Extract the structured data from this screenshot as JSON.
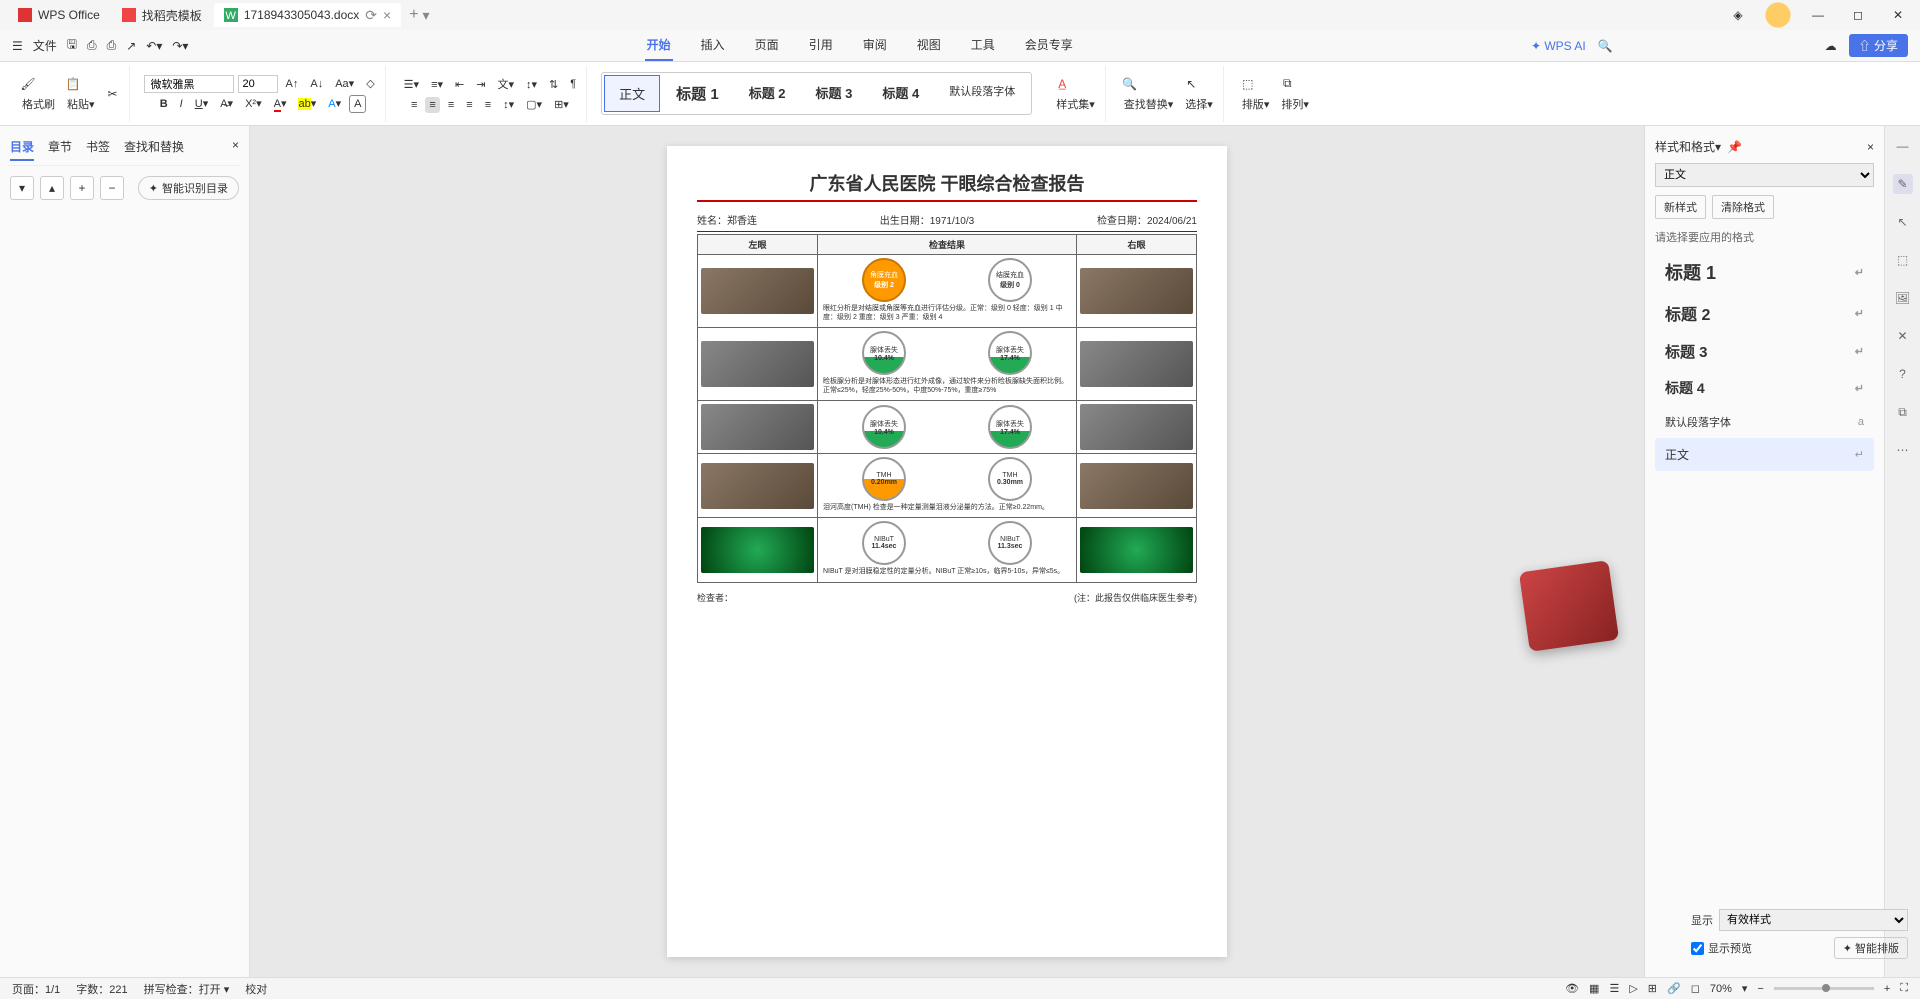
{
  "titlebar": {
    "app": "WPS Office",
    "tab_template": "找稻壳模板",
    "tab_doc": "1718943305043.docx"
  },
  "menubar": {
    "file": "文件",
    "tabs": {
      "start": "开始",
      "insert": "插入",
      "page": "页面",
      "ref": "引用",
      "review": "审阅",
      "view": "视图",
      "tools": "工具",
      "member": "会员专享"
    },
    "ai": "WPS AI",
    "share": "分享"
  },
  "ribbon": {
    "format_painter": "格式刷",
    "paste": "粘贴",
    "font": "微软雅黑",
    "size": "20",
    "styles": {
      "body": "正文",
      "h1": "标题 1",
      "h2": "标题 2",
      "h3": "标题 3",
      "h4": "标题 4",
      "default_para": "默认段落字体"
    },
    "style_set": "样式集",
    "find_replace": "查找替换",
    "select": "选择",
    "arrange1": "排版",
    "arrange2": "排列"
  },
  "left_panel": {
    "tabs": {
      "outline": "目录",
      "chapter": "章节",
      "bookmark": "书签",
      "find": "查找和替换"
    },
    "smart": "智能识别目录"
  },
  "right_panel": {
    "title": "样式和格式",
    "current": "正文",
    "new_style": "新样式",
    "clear": "清除格式",
    "apply_label": "请选择要应用的格式",
    "h1": "标题 1",
    "h2": "标题 2",
    "h3": "标题 3",
    "h4": "标题 4",
    "default_para": "默认段落字体",
    "body": "正文",
    "show": "显示",
    "show_val": "有效样式",
    "preview": "显示预览",
    "smart_layout": "智能排版"
  },
  "doc": {
    "title": "广东省人民医院 干眼综合检查报告",
    "name_lbl": "姓名：",
    "name": "郑香连",
    "dob_lbl": "出生日期：",
    "dob": "1971/10/3",
    "exam_lbl": "检查日期：",
    "exam": "2024/06/21",
    "col_left": "左眼",
    "col_mid": "检查结果",
    "col_right": "右眼",
    "r1": {
      "c1_t": "角膜充血",
      "c1_v": "级别 2",
      "c2_t": "结膜充血",
      "c2_v": "级别 0",
      "desc": "眼红分析是对结膜或角膜等充血进行评估分级。正常：级别 0  轻度：级别 1  中度：级别 2  重度：级别 3  严重：级别 4"
    },
    "r2": {
      "c1_t": "腺体丢失",
      "c1_v": "10.4%",
      "c2_t": "腺体丢失",
      "c2_v": "17.4%",
      "desc": "睑板腺分析是对腺体形态进行红外成像，通过软件来分析睑板腺缺失面积比例。正常≤25%，轻度25%-50%，中度50%-75%，重度≥75%"
    },
    "r3": {
      "c1_t": "腺体丢失",
      "c1_v": "10.4%",
      "c2_t": "腺体丢失",
      "c2_v": "17.4%"
    },
    "r4": {
      "c1_t": "TMH",
      "c1_v": "0.20mm",
      "c2_t": "TMH",
      "c2_v": "0.30mm",
      "desc": "泪河高度(TMH) 检查是一种定量测量泪液分泌量的方法。正常≥0.22mm。"
    },
    "r5": {
      "c1_t": "NIBuT",
      "c1_v": "11.4sec",
      "c2_t": "NIBuT",
      "c2_v": "11.3sec",
      "desc": "NIBuT 是对泪膜稳定性的定量分析。NIBuT 正常≥10s，临界5-10s，异常≤5s。"
    },
    "examiner": "检查者：",
    "note": "(注：此报告仅供临床医生参考)"
  },
  "statusbar": {
    "page": "页面：1/1",
    "words": "字数：221",
    "spell": "拼写检查：打开",
    "proof": "校对",
    "zoom": "70%"
  }
}
